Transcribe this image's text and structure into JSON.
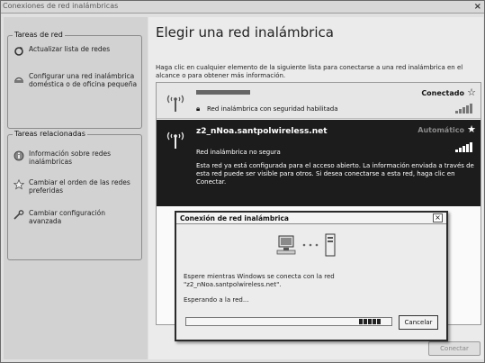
{
  "window": {
    "title": "Conexiones de red inalámbricas",
    "close_glyph": "×"
  },
  "sidebar": {
    "groups": [
      {
        "title": "Tareas de red",
        "items": [
          {
            "label": "Actualizar lista de redes",
            "icon": "refresh-icon"
          },
          {
            "label": "Configurar una red inalámbrica doméstica o de oficina pequeña",
            "icon": "wireless-setup-icon"
          }
        ]
      },
      {
        "title": "Tareas relacionadas",
        "items": [
          {
            "label": "Información sobre redes inalámbricas",
            "icon": "info-icon"
          },
          {
            "label": "Cambiar el orden de las redes preferidas",
            "icon": "star-icon"
          },
          {
            "label": "Cambiar configuración avanzada",
            "icon": "settings-icon"
          }
        ]
      }
    ]
  },
  "main": {
    "title": "Elegir una red inalámbrica",
    "description": "Haga clic en cualquier elemento de la siguiente lista para conectarse a una red inalámbrica en el alcance o para obtener más información.",
    "networks": [
      {
        "name": "",
        "status": "Conectado",
        "security": "Red inalámbrica con seguridad habilitada",
        "signal_bars": 5
      },
      {
        "name": "z2_nNoa.santpolwireless.net",
        "status": "Automático",
        "security": "Red inalámbrica no segura",
        "detail": "Esta red ya está configurada para el acceso abierto. La información enviada a través de esta red puede ser visible para otros. Si desea conectarse a esta red, haga clic en Conectar.",
        "signal_bars": 5
      }
    ],
    "connect_label": "Conectar"
  },
  "dialog": {
    "title": "Conexión de red inalámbrica",
    "close_glyph": "×",
    "message": "Espere mientras Windows se conecta con la red \"z2_nNoa.santpolwireless.net\".",
    "status": "Esperando a la red...",
    "cancel_label": "Cancelar",
    "progress_blocks": 5
  },
  "colors": {
    "selected_row": "#1c1c1c",
    "connected_row": "#e6e6e6"
  }
}
